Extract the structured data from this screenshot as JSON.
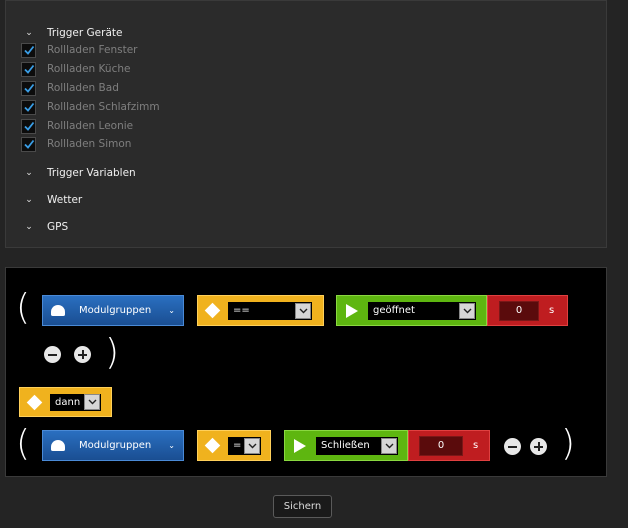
{
  "trigger_groups": {
    "devices": {
      "label": "Trigger Geräte",
      "items": [
        {
          "label": "Rollladen Fenster",
          "checked": true
        },
        {
          "label": "Rollladen Küche",
          "checked": true
        },
        {
          "label": "Rollladen Bad",
          "checked": true
        },
        {
          "label": "Rollladen Schlafzimm",
          "checked": true
        },
        {
          "label": "Rollladen Leonie",
          "checked": true
        },
        {
          "label": "Rollladen Simon",
          "checked": true
        }
      ]
    },
    "variables": {
      "label": "Trigger Variablen"
    },
    "weather": {
      "label": "Wetter"
    },
    "gps": {
      "label": "GPS"
    }
  },
  "rule": {
    "condition": {
      "module": "Modulgruppen",
      "operator": "==",
      "value": "geöffnet",
      "delay": "0",
      "unit": "s"
    },
    "connector": "dann",
    "action": {
      "module": "Modulgruppen",
      "operator": "=",
      "value": "Schließen",
      "delay": "0",
      "unit": "s"
    },
    "open_paren": "(",
    "close_paren": ")"
  },
  "colors": {
    "module": "#1f5fae",
    "operator": "#f0b21e",
    "value": "#5eb610",
    "delay": "#bf1d20"
  },
  "icons": {
    "chevron": "chevron-down-icon",
    "check": "check-icon",
    "module": "cloud-icon",
    "operator": "diamond-icon",
    "value": "play-icon"
  },
  "save_label": "Sichern"
}
